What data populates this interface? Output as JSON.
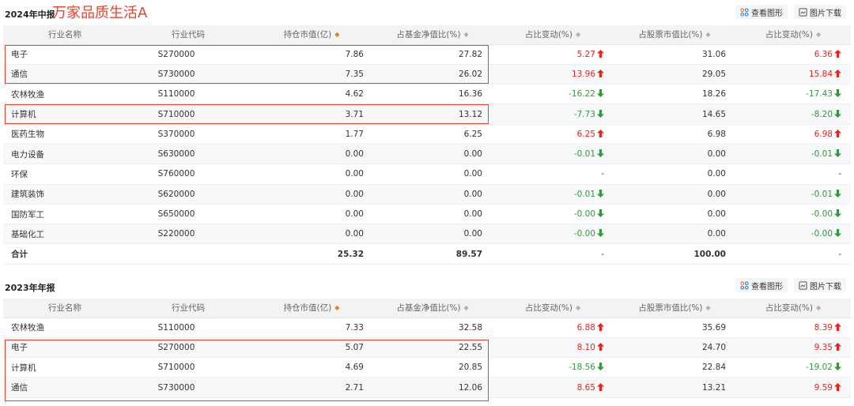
{
  "sections": [
    {
      "title": "2024年中报",
      "annotation": "万家品质生活A",
      "tools": {
        "view_chart": "查看图形",
        "download_image": "图片下载"
      },
      "columns": [
        "行业名称",
        "行业代码",
        "持仓市值(亿)",
        "占基金净值比(%)",
        "占比变动(%)",
        "占股票市值比(%)",
        "占比变动(%)"
      ],
      "rows": [
        {
          "name": "电子",
          "code": "S270000",
          "mv": "7.86",
          "nav": "27.82",
          "chg1": "5.27",
          "chg1_dir": "up",
          "stock": "31.06",
          "chg2": "6.36",
          "chg2_dir": "up"
        },
        {
          "name": "通信",
          "code": "S730000",
          "mv": "7.35",
          "nav": "26.02",
          "chg1": "13.96",
          "chg1_dir": "up",
          "stock": "29.05",
          "chg2": "15.84",
          "chg2_dir": "up"
        },
        {
          "name": "农林牧渔",
          "code": "S110000",
          "mv": "4.62",
          "nav": "16.36",
          "chg1": "-16.22",
          "chg1_dir": "down",
          "stock": "18.26",
          "chg2": "-17.43",
          "chg2_dir": "down"
        },
        {
          "name": "计算机",
          "code": "S710000",
          "mv": "3.71",
          "nav": "13.12",
          "chg1": "-7.73",
          "chg1_dir": "down",
          "stock": "14.65",
          "chg2": "-8.20",
          "chg2_dir": "down"
        },
        {
          "name": "医药生物",
          "code": "S370000",
          "mv": "1.77",
          "nav": "6.25",
          "chg1": "6.25",
          "chg1_dir": "up",
          "stock": "6.98",
          "chg2": "6.98",
          "chg2_dir": "up"
        },
        {
          "name": "电力设备",
          "code": "S630000",
          "mv": "0.00",
          "nav": "0.00",
          "chg1": "-0.01",
          "chg1_dir": "down",
          "stock": "0.00",
          "chg2": "-0.01",
          "chg2_dir": "down"
        },
        {
          "name": "环保",
          "code": "S760000",
          "mv": "0.00",
          "nav": "0.00",
          "chg1": "-",
          "chg1_dir": "none",
          "stock": "0.00",
          "chg2": "-",
          "chg2_dir": "none"
        },
        {
          "name": "建筑装饰",
          "code": "S620000",
          "mv": "0.00",
          "nav": "0.00",
          "chg1": "-0.01",
          "chg1_dir": "down",
          "stock": "0.00",
          "chg2": "-0.01",
          "chg2_dir": "down"
        },
        {
          "name": "国防军工",
          "code": "S650000",
          "mv": "0.00",
          "nav": "0.00",
          "chg1": "-0.00",
          "chg1_dir": "down",
          "stock": "0.00",
          "chg2": "-0.00",
          "chg2_dir": "down"
        },
        {
          "name": "基础化工",
          "code": "S220000",
          "mv": "0.00",
          "nav": "0.00",
          "chg1": "-0.00",
          "chg1_dir": "down",
          "stock": "0.00",
          "chg2": "-0.00",
          "chg2_dir": "down"
        }
      ],
      "total": {
        "name": "合计",
        "code": "",
        "mv": "25.32",
        "nav": "89.57",
        "chg1": "-",
        "stock": "100.00",
        "chg2": "-"
      }
    },
    {
      "title": "2023年年报",
      "tools": {
        "view_chart": "查看图形",
        "download_image": "图片下载"
      },
      "columns": [
        "行业名称",
        "行业代码",
        "持仓市值(亿)",
        "占基金净值比(%)",
        "占比变动(%)",
        "占股票市值比(%)",
        "占比变动(%)"
      ],
      "rows": [
        {
          "name": "农林牧渔",
          "code": "S110000",
          "mv": "7.33",
          "nav": "32.58",
          "chg1": "6.88",
          "chg1_dir": "up",
          "stock": "35.69",
          "chg2": "8.39",
          "chg2_dir": "up"
        },
        {
          "name": "电子",
          "code": "S270000",
          "mv": "5.07",
          "nav": "22.55",
          "chg1": "8.10",
          "chg1_dir": "up",
          "stock": "24.70",
          "chg2": "9.35",
          "chg2_dir": "up"
        },
        {
          "name": "计算机",
          "code": "S710000",
          "mv": "4.69",
          "nav": "20.85",
          "chg1": "-18.56",
          "chg1_dir": "down",
          "stock": "22.84",
          "chg2": "-19.02",
          "chg2_dir": "down"
        },
        {
          "name": "通信",
          "code": "S730000",
          "mv": "2.71",
          "nav": "12.06",
          "chg1": "8.65",
          "chg1_dir": "up",
          "stock": "13.21",
          "chg2": "9.59",
          "chg2_dir": "up"
        }
      ]
    }
  ],
  "colors": {
    "up": "#e8231e",
    "down": "#2e9a3a",
    "highlight": "#e8432e",
    "sort_active": "#f07a1a"
  }
}
